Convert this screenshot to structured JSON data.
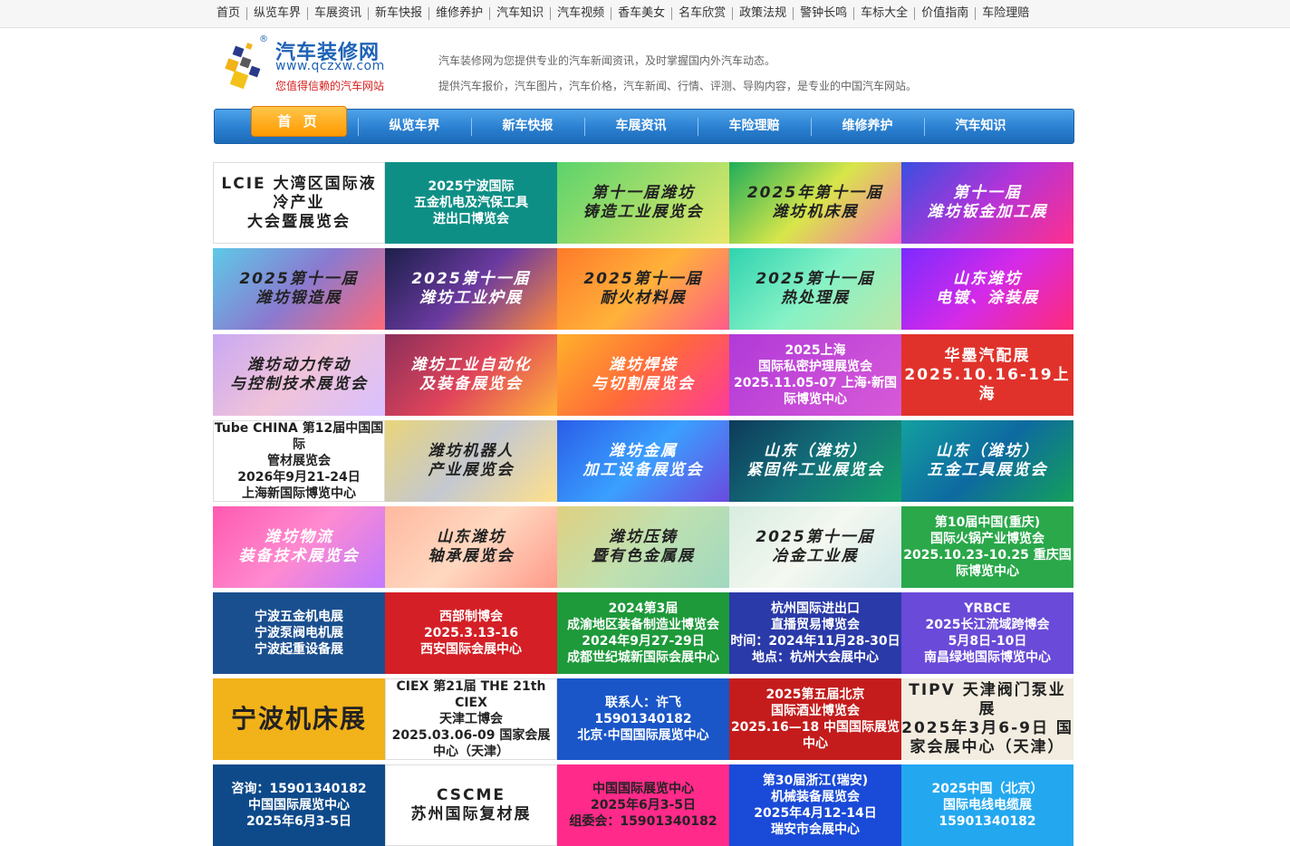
{
  "top_nav": [
    "首页",
    "纵览车界",
    "车展资讯",
    "新车快报",
    "维修养护",
    "汽车知识",
    "汽车视频",
    "香车美女",
    "名车欣赏",
    "政策法规",
    "警钟长鸣",
    "车标大全",
    "价值指南",
    "车险理赔"
  ],
  "logo": {
    "name": "汽车装修网",
    "reg": "®",
    "url": "www.qczxw.com",
    "slogan": "您值得信赖的汽车网站"
  },
  "intro": {
    "line1": "汽车装修网为您提供专业的汽车新闻资讯，及时掌握国内外汽车动态。",
    "line2": "提供汽车报价，汽车图片，汽车价格，汽车新闻、行情、评测、导购内容，是专业的中国汽车网站。"
  },
  "main_nav": {
    "home": "首 页",
    "items": [
      "纵览车界",
      "新车快报",
      "车展资讯",
      "车险理赔",
      "维修养护",
      "汽车知识"
    ]
  },
  "colors": {
    "nav_blue": "#2a7fd0",
    "home_orange": "#ff9a00",
    "logo_blue": "#1e62b5",
    "slogan_red": "#d61d1d"
  },
  "banners": [
    {
      "text": "LCIE 大湾区国际液冷产业\n大会暨展览会",
      "bg": "#ffffff",
      "style": "light plain"
    },
    {
      "text": "2025宁波国际\n五金机电及汽保工具\n进出口博览会",
      "bg": "#0e8f86",
      "style": "dark plain"
    },
    {
      "text": "第十一届潍坊\n铸造工业展览会",
      "bg": "linear-gradient(135deg,#5bd36b,#e7e86a)",
      "style": "light"
    },
    {
      "text": "2025年第十一届\n潍坊机床展",
      "bg": "linear-gradient(135deg,#1fae5a,#d8e64a,#ff6fb0)",
      "style": "light"
    },
    {
      "text": "第十一届\n潍坊钣金加工展",
      "bg": "linear-gradient(135deg,#3a4fe0,#b334d8,#ff2f8e)",
      "style": "dark"
    },
    {
      "text": "2025第十一届\n潍坊锻造展",
      "bg": "linear-gradient(135deg,#5ec9e8,#8a7ad0,#ff6a7a)",
      "style": "light"
    },
    {
      "text": "2025第十一届\n潍坊工业炉展",
      "bg": "linear-gradient(135deg,#1c1f4a,#6b3aa0,#ff8a3a)",
      "style": "dark"
    },
    {
      "text": "2025第十一届\n耐火材料展",
      "bg": "linear-gradient(135deg,#ff7a2a,#ffb23a,#ff5a8a)",
      "style": "light"
    },
    {
      "text": "2025第十一届\n热处理展",
      "bg": "linear-gradient(135deg,#2fd3b0,#86f2c6,#bde7a8)",
      "style": "light"
    },
    {
      "text": "山东潍坊\n电镀、涂装展",
      "bg": "linear-gradient(135deg,#7b2bff,#d42ae8,#ff2a7a)",
      "style": "dark"
    },
    {
      "text": "潍坊动力传动\n与控制技术展览会",
      "bg": "linear-gradient(135deg,#c9a8f3,#f0c3d9,#d8c0ff)",
      "style": "light"
    },
    {
      "text": "潍坊工业自动化\n及装备展览会",
      "bg": "linear-gradient(135deg,#8a2f5a,#e0445a,#ffb33a)",
      "style": "dark"
    },
    {
      "text": "潍坊焊接\n与切割展览会",
      "bg": "linear-gradient(135deg,#ffb12a,#ff6a3a,#ff3a9a)",
      "style": "dark"
    },
    {
      "text": "2025上海\n国际私密护理展览会\n2025.11.05-07  上海·新国际博览中心",
      "bg": "linear-gradient(135deg,#b13ad8,#d85ad8)",
      "style": "dark plain"
    },
    {
      "text": "华墨汽配展\n2025.10.16-19上海",
      "bg": "#e0322a",
      "style": "dark plain"
    },
    {
      "text": "Tube CHINA 第12届中国国际\n管材展览会\n2026年9月21-24日\n上海新国际博览中心",
      "bg": "#ffffff",
      "style": "light plain"
    },
    {
      "text": "潍坊机器人\n产业展览会",
      "bg": "linear-gradient(135deg,#e9d57a,#c4c8d0,#ffe08a)",
      "style": "light"
    },
    {
      "text": "潍坊金属\n加工设备展览会",
      "bg": "linear-gradient(135deg,#2a5de8,#3aa0ff,#6a4ae0)",
      "style": "dark"
    },
    {
      "text": "山东（潍坊）\n紧固件工业展览会",
      "bg": "linear-gradient(135deg,#0e3a5a,#13707a,#14a06a)",
      "style": "dark"
    },
    {
      "text": "山东（潍坊）\n五金工具展览会",
      "bg": "linear-gradient(135deg,#13a0a0,#0e6aa0,#14a05a)",
      "style": "dark"
    },
    {
      "text": "潍坊物流\n装备技术展览会",
      "bg": "linear-gradient(135deg,#ff5ab0,#ff8ad0,#c07aff)",
      "style": "dark"
    },
    {
      "text": "山东潍坊\n轴承展览会",
      "bg": "linear-gradient(135deg,#ffb8a0,#ffd8c0,#ff9a8a)",
      "style": "light"
    },
    {
      "text": "潍坊压铸\n暨有色金属展",
      "bg": "linear-gradient(135deg,#e0d080,#c0e0b0,#a0d8c0)",
      "style": "light"
    },
    {
      "text": "2025第十一届\n冶金工业展",
      "bg": "linear-gradient(135deg,#d8ece0,#f4f8f0,#cfe8e8)",
      "style": "light"
    },
    {
      "text": "第10届中国(重庆)\n国际火锅产业博览会\n2025.10.23-10.25 重庆国际博览中心",
      "bg": "#2aa84a",
      "style": "dark plain"
    },
    {
      "text": "宁波五金机电展\n宁波泵阀电机展\n宁波起重设备展",
      "bg": "#1a4f8f",
      "style": "dark plain"
    },
    {
      "text": "西部制博会\n2025.3.13-16\n西安国际会展中心",
      "bg": "#d41f26",
      "style": "dark plain"
    },
    {
      "text": "2024第3届\n成渝地区装备制造业博览会\n2024年9月27-29日\n成都世纪城新国际会展中心",
      "bg": "#1e9a3a",
      "style": "dark plain"
    },
    {
      "text": "杭州国际进出口\n直播贸易博览会\n时间：2024年11月28-30日\n地点：杭州大会展中心",
      "bg": "#2a3aa8",
      "style": "dark plain"
    },
    {
      "text": "YRBCE\n2025长江流域跨博会\n5月8日-10日\n南昌绿地国际博览中心",
      "bg": "#6a4ad8",
      "style": "dark plain"
    },
    {
      "text": "宁波机床展",
      "bg": "#f2b21a",
      "style": "light plain"
    },
    {
      "text": "CIEX 第21届 THE 21th CIEX\n天津工博会\n2025.03.06-09 国家会展中心（天津）",
      "bg": "#ffffff",
      "style": "light plain"
    },
    {
      "text": "联系人：许飞\n15901340182\n北京·中国国际展览中心",
      "bg": "#1a56c8",
      "style": "dark plain"
    },
    {
      "text": "2025第五届北京\n国际酒业博览会\n2025.16—18 中国国际展览中心",
      "bg": "#c41c1c",
      "style": "dark plain"
    },
    {
      "text": "TIPV 天津阀门泵业展\n2025年3月6-9日 国家会展中心（天津）",
      "bg": "#f2ede0",
      "style": "light plain"
    },
    {
      "text": "咨询：15901340182\n中国国际展览中心\n2025年6月3-5日",
      "bg": "#0e4a8a",
      "style": "dark plain"
    },
    {
      "text": "CSCME\n苏州国际复材展",
      "bg": "#ffffff",
      "style": "light plain"
    },
    {
      "text": "中国国际展览中心\n2025年6月3-5日\n组委会：15901340182",
      "bg": "#ff2a8a",
      "style": "light plain"
    },
    {
      "text": "第30届浙江(瑞安)\n机械装备展览会\n2025年4月12-14日\n瑞安市会展中心",
      "bg": "#1a4ad8",
      "style": "dark plain"
    },
    {
      "text": "2025中国（北京）\n国际电线电缆展\n15901340182",
      "bg": "#23a8f0",
      "style": "dark plain"
    }
  ]
}
